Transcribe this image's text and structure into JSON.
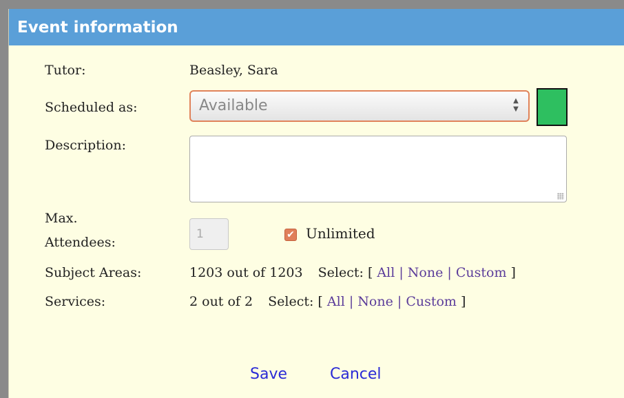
{
  "dialog": {
    "title": "Event information"
  },
  "tutor": {
    "label": "Tutor:",
    "value": "Beasley, Sara"
  },
  "scheduled": {
    "label": "Scheduled as:",
    "value": "Available",
    "color": "#2ebf60"
  },
  "description": {
    "label": "Description:",
    "value": ""
  },
  "attendees": {
    "label_line1": "Max.",
    "label_line2": "Attendees:",
    "value": "1",
    "unlimited_label": "Unlimited",
    "unlimited_checked": true
  },
  "subject_areas": {
    "label": "Subject Areas:",
    "count": "1203 out of 1203",
    "select_label": "Select: [",
    "all": "All",
    "none": "None",
    "custom": "Custom",
    "sep": "|",
    "close": "]"
  },
  "services": {
    "label": "Services:",
    "count": "2 out of 2",
    "select_label": "Select: [",
    "all": "All",
    "none": "None",
    "custom": "Custom",
    "sep": "|",
    "close": "]"
  },
  "actions": {
    "save": "Save",
    "cancel": "Cancel"
  },
  "colors": {
    "title_bar": "#5a9fd8",
    "background": "#fefee3",
    "link": "#5b3c9a",
    "button": "#2a2ad6"
  }
}
